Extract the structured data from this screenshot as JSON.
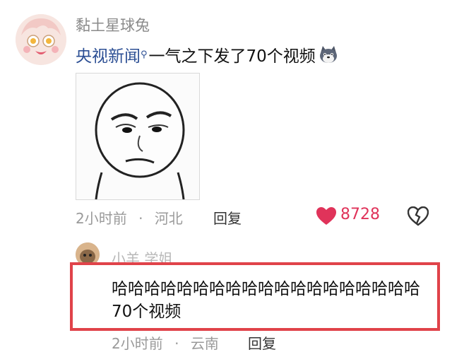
{
  "first_comment": {
    "username": "黏土星球兔",
    "mention": "央视新闻",
    "text": "一气之下发了70个视频",
    "emoji": "doge-emoji",
    "meme": "staring-face-meme",
    "time": "2小时前",
    "location": "河北",
    "separator": "·",
    "reply_label": "回复",
    "likes": "8728"
  },
  "reply_comment": {
    "username": "小羊  学姐",
    "text": "哈哈哈哈哈哈哈哈哈哈哈哈哈哈哈哈哈哈哈70个视频",
    "time": "2小时前",
    "location": "云南",
    "separator": "·",
    "reply_label": "回复"
  },
  "colors": {
    "mention": "#2c4f94",
    "like": "#e0335a",
    "highlight_border": "#e0434a"
  }
}
